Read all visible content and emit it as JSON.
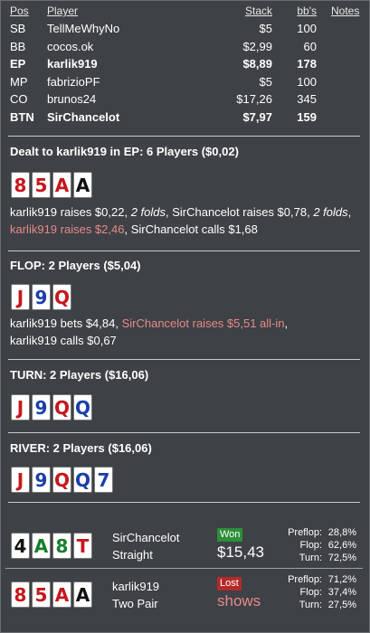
{
  "table": {
    "headers": {
      "pos": "Pos",
      "player": "Player",
      "stack": "Stack",
      "bbs": "bb's",
      "notes": "Notes"
    },
    "players": [
      {
        "pos": "SB",
        "player": "TellMeWhyNo",
        "stack": "$5",
        "bbs": "100",
        "hero": false
      },
      {
        "pos": "BB",
        "player": "cocos.ok",
        "stack": "$2,99",
        "bbs": "60",
        "hero": false
      },
      {
        "pos": "EP",
        "player": "karlik919",
        "stack": "$8,89",
        "bbs": "178",
        "hero": true
      },
      {
        "pos": "MP",
        "player": "fabrizioPF",
        "stack": "$5",
        "bbs": "100",
        "hero": false
      },
      {
        "pos": "CO",
        "player": "brunos24",
        "stack": "$17,26",
        "bbs": "345",
        "hero": false
      },
      {
        "pos": "BTN",
        "player": "SirChancelot",
        "stack": "$7,97",
        "bbs": "159",
        "hero": true
      }
    ]
  },
  "preflop": {
    "title": "Dealt to karlik919 in EP: 6 Players ($0,02)",
    "cards": [
      {
        "rank": "8",
        "suit": "red"
      },
      {
        "rank": "5",
        "suit": "red"
      },
      {
        "rank": "A",
        "suit": "red"
      },
      {
        "rank": "A",
        "suit": "black"
      }
    ],
    "action": {
      "p1": "karlik919 raises $0,22, ",
      "p2": "2 folds",
      "p3": ", SirChancelot raises $0,78, ",
      "p4": "2 folds",
      "p5": ", ",
      "p6": "karlik919 raises $2,46",
      "p7": ", SirChancelot calls $1,68"
    }
  },
  "flop": {
    "title": "FLOP: 2 Players ($5,04)",
    "cards": [
      {
        "rank": "J",
        "suit": "red"
      },
      {
        "rank": "9",
        "suit": "blue"
      },
      {
        "rank": "Q",
        "suit": "red"
      }
    ],
    "action": {
      "p1": "karlik919 bets $4,84, ",
      "p2": "SirChancelot raises $5,51 all-in",
      "p3": ",",
      "p4": "karlik919 calls $0,67"
    }
  },
  "turn": {
    "title": "TURN: 2 Players ($16,06)",
    "cards": [
      {
        "rank": "J",
        "suit": "red"
      },
      {
        "rank": "9",
        "suit": "blue"
      },
      {
        "rank": "Q",
        "suit": "red"
      },
      {
        "rank": "Q",
        "suit": "blue"
      }
    ]
  },
  "river": {
    "title": "RIVER: 2 Players ($16,06)",
    "cards": [
      {
        "rank": "J",
        "suit": "red"
      },
      {
        "rank": "9",
        "suit": "blue"
      },
      {
        "rank": "Q",
        "suit": "red"
      },
      {
        "rank": "Q",
        "suit": "blue"
      },
      {
        "rank": "7",
        "suit": "blue"
      }
    ]
  },
  "results": [
    {
      "cards": [
        {
          "rank": "4",
          "suit": "black"
        },
        {
          "rank": "A",
          "suit": "green"
        },
        {
          "rank": "8",
          "suit": "green"
        },
        {
          "rank": "T",
          "suit": "red"
        }
      ],
      "player": "SirChancelot",
      "hand": "Straight",
      "badge": "Won",
      "outcome": "$15,43",
      "equity": [
        {
          "label": "Preflop:",
          "value": "28,8%"
        },
        {
          "label": "Flop:",
          "value": "62,6%"
        },
        {
          "label": "Turn:",
          "value": "72,5%"
        }
      ]
    },
    {
      "cards": [
        {
          "rank": "8",
          "suit": "red"
        },
        {
          "rank": "5",
          "suit": "red"
        },
        {
          "rank": "A",
          "suit": "red"
        },
        {
          "rank": "A",
          "suit": "black"
        }
      ],
      "player": "karlik919",
      "hand": "Two Pair",
      "badge": "Lost",
      "outcome": "shows",
      "equity": [
        {
          "label": "Preflop:",
          "value": "71,2%"
        },
        {
          "label": "Flop:",
          "value": "37,4%"
        },
        {
          "label": "Turn:",
          "value": "27,5%"
        }
      ]
    }
  ],
  "colors": {
    "background": "#3e4145",
    "suit_red": "#c5171c",
    "suit_blue": "#1b3fa9",
    "suit_green": "#15802a",
    "suit_black": "#111111",
    "highlight_red": "#e8898a",
    "won_badge": "#2c8f3a",
    "lost_badge": "#b42a2b"
  }
}
